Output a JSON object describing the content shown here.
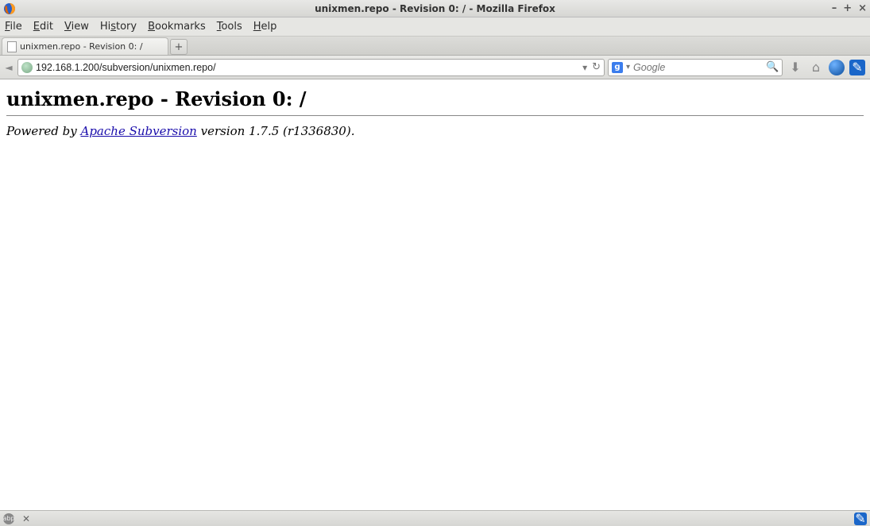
{
  "window": {
    "title": "unixmen.repo - Revision 0: / - Mozilla Firefox"
  },
  "menubar": {
    "items": [
      "File",
      "Edit",
      "View",
      "History",
      "Bookmarks",
      "Tools",
      "Help"
    ]
  },
  "tabs": {
    "active_label": "unixmen.repo - Revision 0: /",
    "newtab_symbol": "+"
  },
  "urlbar": {
    "value": "192.168.1.200/subversion/unixmen.repo/",
    "dropdown_symbol": "▾",
    "reload_symbol": "↻"
  },
  "searchbar": {
    "engine_letter": "g",
    "placeholder": "Google",
    "dropdown_symbol": "▾",
    "mag_symbol": "🔍"
  },
  "nav_icons": {
    "back_symbol": "◄",
    "download_symbol": "⬇",
    "home_symbol": "⌂",
    "pencil_symbol": "✎"
  },
  "page": {
    "heading": "unixmen.repo - Revision 0: /",
    "powered_prefix": "Powered by ",
    "link_text": "Apache Subversion",
    "version_suffix": " version 1.7.5 (r1336830)."
  },
  "taskbar": {
    "close_symbol": "✕",
    "pencil_symbol": "✎"
  },
  "win_controls": {
    "min": "–",
    "max": "+",
    "close": "×"
  }
}
